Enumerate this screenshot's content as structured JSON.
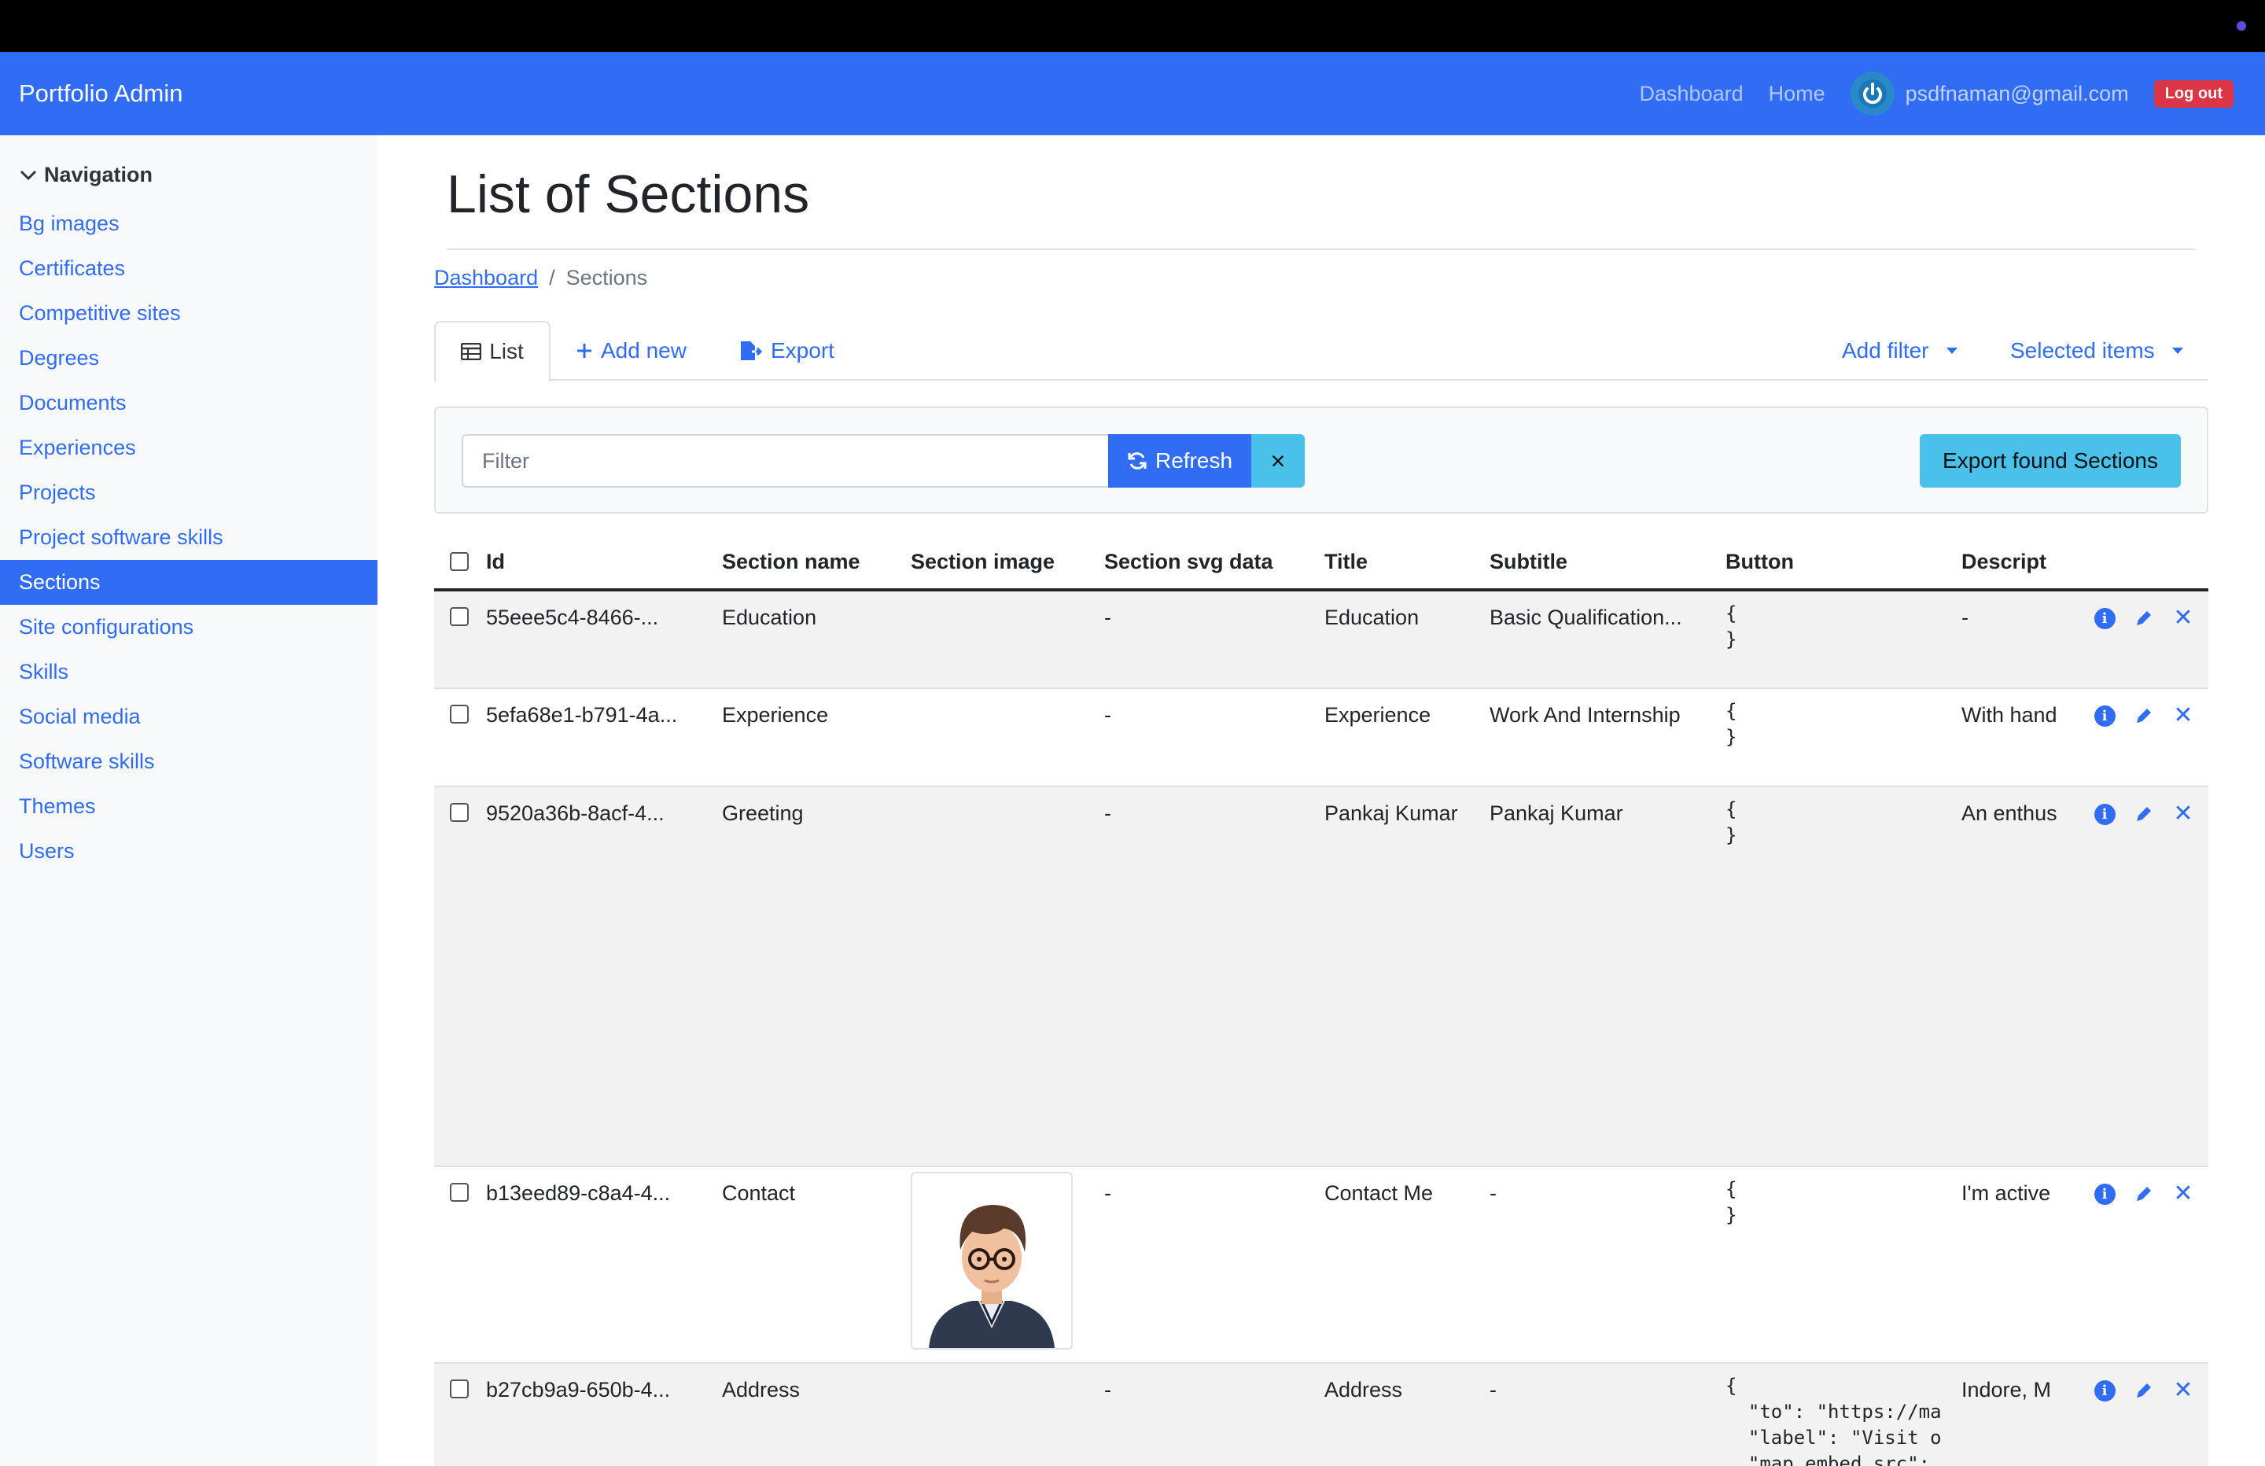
{
  "app": {
    "brand": "Portfolio Admin",
    "nav_dashboard": "Dashboard",
    "nav_home": "Home",
    "user_email": "psdfnaman@gmail.com",
    "logout": "Log out"
  },
  "sidebar": {
    "heading": "Navigation",
    "items": [
      {
        "label": "Bg images",
        "active": false
      },
      {
        "label": "Certificates",
        "active": false
      },
      {
        "label": "Competitive sites",
        "active": false
      },
      {
        "label": "Degrees",
        "active": false
      },
      {
        "label": "Documents",
        "active": false
      },
      {
        "label": "Experiences",
        "active": false
      },
      {
        "label": "Projects",
        "active": false
      },
      {
        "label": "Project software skills",
        "active": false
      },
      {
        "label": "Sections",
        "active": true
      },
      {
        "label": "Site configurations",
        "active": false
      },
      {
        "label": "Skills",
        "active": false
      },
      {
        "label": "Social media",
        "active": false
      },
      {
        "label": "Software skills",
        "active": false
      },
      {
        "label": "Themes",
        "active": false
      },
      {
        "label": "Users",
        "active": false
      }
    ]
  },
  "page": {
    "title": "List of Sections",
    "breadcrumb": {
      "root": "Dashboard",
      "separator": "/",
      "current": "Sections"
    }
  },
  "tabs": {
    "list": "List",
    "add_new": "Add new",
    "export": "Export",
    "add_filter": "Add filter",
    "selected_items": "Selected items"
  },
  "filter": {
    "placeholder": "Filter",
    "value": "",
    "refresh": "Refresh",
    "clear": "×",
    "export_found": "Export found Sections"
  },
  "table": {
    "headers": {
      "id": "Id",
      "section_name": "Section name",
      "section_image": "Section image",
      "section_svg": "Section svg data",
      "title": "Title",
      "subtitle": "Subtitle",
      "button": "Button",
      "description": "Descript"
    },
    "rows": [
      {
        "id": "55eee5c4-8466-...",
        "section_name": "Education",
        "svg": "-",
        "title": "Education",
        "subtitle": "Basic Qualification...",
        "button": "{\n}",
        "description": "-"
      },
      {
        "id": "5efa68e1-b791-4a...",
        "section_name": "Experience",
        "svg": "-",
        "title": "Experience",
        "subtitle": "Work And Internship",
        "button": "{\n}",
        "description": "With hand"
      },
      {
        "id": "9520a36b-8acf-4...",
        "section_name": "Greeting",
        "svg": "-",
        "title": "Pankaj Kumar",
        "subtitle": "Pankaj Kumar",
        "button": "{\n}",
        "description": "An enthus"
      },
      {
        "id": "b13eed89-c8a4-4...",
        "section_name": "Contact",
        "svg": "-",
        "title": "Contact Me",
        "subtitle": "-",
        "button": "{\n}",
        "description": "I'm active"
      },
      {
        "id": "b27cb9a9-650b-4...",
        "section_name": "Address",
        "svg": "-",
        "title": "Address",
        "subtitle": "-",
        "button": "{\n  \"to\": \"https://ma\n  \"label\": \"Visit o\n  \"map_embed_src\":",
        "description": "Indore, M"
      }
    ]
  },
  "icons": {
    "brand_color": "#316cf4",
    "info": "info-icon",
    "edit": "pencil-icon",
    "delete": "close-icon",
    "list": "table-icon",
    "add": "plus-icon",
    "export": "file-export-icon",
    "refresh": "refresh-icon",
    "nav_toggle": "chevron-down-icon",
    "avatar": "power-icon"
  }
}
